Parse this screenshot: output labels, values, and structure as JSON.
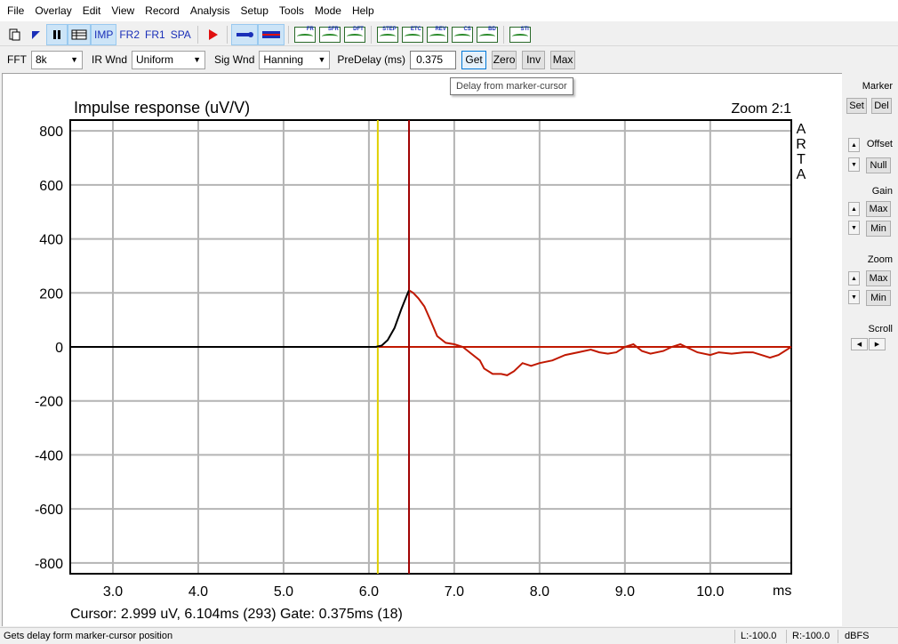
{
  "menu": [
    "File",
    "Overlay",
    "Edit",
    "View",
    "Record",
    "Analysis",
    "Setup",
    "Tools",
    "Mode",
    "Help"
  ],
  "toolbar": {
    "imp_label": "IMP",
    "fr2_label": "FR2",
    "fr1_label": "FR1",
    "spa_label": "SPA",
    "mini_icons": [
      {
        "name": "fr-graph-icon",
        "text": "FR"
      },
      {
        "name": "sfr-graph-icon",
        "text": "SFR"
      },
      {
        "name": "dft-graph-icon",
        "text": "DFT"
      },
      {
        "name": "step-graph-icon",
        "text": "STEP"
      },
      {
        "name": "etc-graph-icon",
        "text": "ETC"
      },
      {
        "name": "rev-graph-icon",
        "text": "REV"
      },
      {
        "name": "cs-graph-icon",
        "text": "CS"
      },
      {
        "name": "bd-graph-icon",
        "text": "BD"
      },
      {
        "name": "sti-graph-icon",
        "text": "STI"
      }
    ]
  },
  "options": {
    "fft_label": "FFT",
    "fft_value": "8k",
    "irwnd_label": "IR Wnd",
    "irwnd_value": "Uniform",
    "sigwnd_label": "Sig Wnd",
    "sigwnd_value": "Hanning",
    "predelay_label": "PreDelay (ms)",
    "predelay_value": "0.375",
    "get_label": "Get",
    "zero_label": "Zero",
    "inv_label": "Inv",
    "max_label": "Max"
  },
  "tooltip": "Delay from marker-cursor",
  "right_panel": {
    "marker_title": "Marker",
    "set_label": "Set",
    "del_label": "Del",
    "offset_title": "Offset",
    "null_label": "Null",
    "gain_title": "Gain",
    "gain_max": "Max",
    "gain_min": "Min",
    "zoom_title": "Zoom",
    "zoom_max": "Max",
    "zoom_min": "Min",
    "scroll_title": "Scroll"
  },
  "plot": {
    "zoom_text": "Zoom 2:1",
    "watermark": [
      "A",
      "R",
      "T",
      "A"
    ],
    "cursor_text": "Cursor: 2.999 uV, 6.104ms (293)  Gate: 0.375ms (18)"
  },
  "status": {
    "message": "Gets delay form marker-cursor position",
    "left_level": "L:-100.0",
    "right_level": "R:-100.0",
    "unit": "dBFS"
  },
  "colors": {
    "grid": "#b4b4b4",
    "pre_trace": "#000000",
    "gated_trace": "#c01800",
    "cursor_line": "#a00000",
    "marker_line": "#e0d000",
    "zero_line": "#c01800",
    "accent": "#1a2fb8"
  },
  "chart_data": {
    "type": "line",
    "title": "Impulse response (uV/V)",
    "xlabel": "ms",
    "ylabel": "",
    "xlim": [
      2.5,
      10.95
    ],
    "ylim": [
      -840,
      840
    ],
    "xticks": [
      3.0,
      4.0,
      5.0,
      6.0,
      7.0,
      8.0,
      9.0,
      10.0
    ],
    "xtick_labels": [
      "3.0",
      "4.0",
      "5.0",
      "6.0",
      "7.0",
      "8.0",
      "9.0",
      "10.0"
    ],
    "yticks": [
      800,
      600,
      400,
      200,
      0,
      -200,
      -400,
      -600,
      -800
    ],
    "ytick_labels": [
      "800",
      "600",
      "400",
      "200",
      "0",
      "-200",
      "-400",
      "-600",
      "-800"
    ],
    "grid": true,
    "marker_ms": 6.104,
    "cursor_ms": 6.47,
    "series": [
      {
        "color": "#000000",
        "x": [
          2.5,
          6.08,
          6.15,
          6.22,
          6.3,
          6.38,
          6.45,
          6.47
        ],
        "y": [
          0,
          0,
          5,
          25,
          70,
          140,
          195,
          210
        ]
      },
      {
        "color": "#c01800",
        "x": [
          6.47,
          6.52,
          6.58,
          6.65,
          6.72,
          6.8,
          6.9,
          7.0,
          7.1,
          7.2,
          7.3,
          7.35,
          7.45,
          7.55,
          7.62,
          7.7,
          7.8,
          7.9,
          8.0,
          8.15,
          8.3,
          8.45,
          8.6,
          8.7,
          8.8,
          8.9,
          9.0,
          9.1,
          9.2,
          9.3,
          9.45,
          9.55,
          9.65,
          9.75,
          9.85,
          10.0,
          10.1,
          10.25,
          10.4,
          10.5,
          10.6,
          10.7,
          10.8,
          10.95
        ],
        "y": [
          210,
          200,
          180,
          150,
          100,
          40,
          15,
          10,
          0,
          -25,
          -50,
          -80,
          -100,
          -100,
          -105,
          -90,
          -60,
          -70,
          -60,
          -50,
          -30,
          -20,
          -10,
          -20,
          -25,
          -20,
          0,
          10,
          -15,
          -25,
          -15,
          0,
          10,
          -5,
          -20,
          -30,
          -20,
          -25,
          -20,
          -20,
          -30,
          -40,
          -30,
          0
        ]
      }
    ]
  }
}
